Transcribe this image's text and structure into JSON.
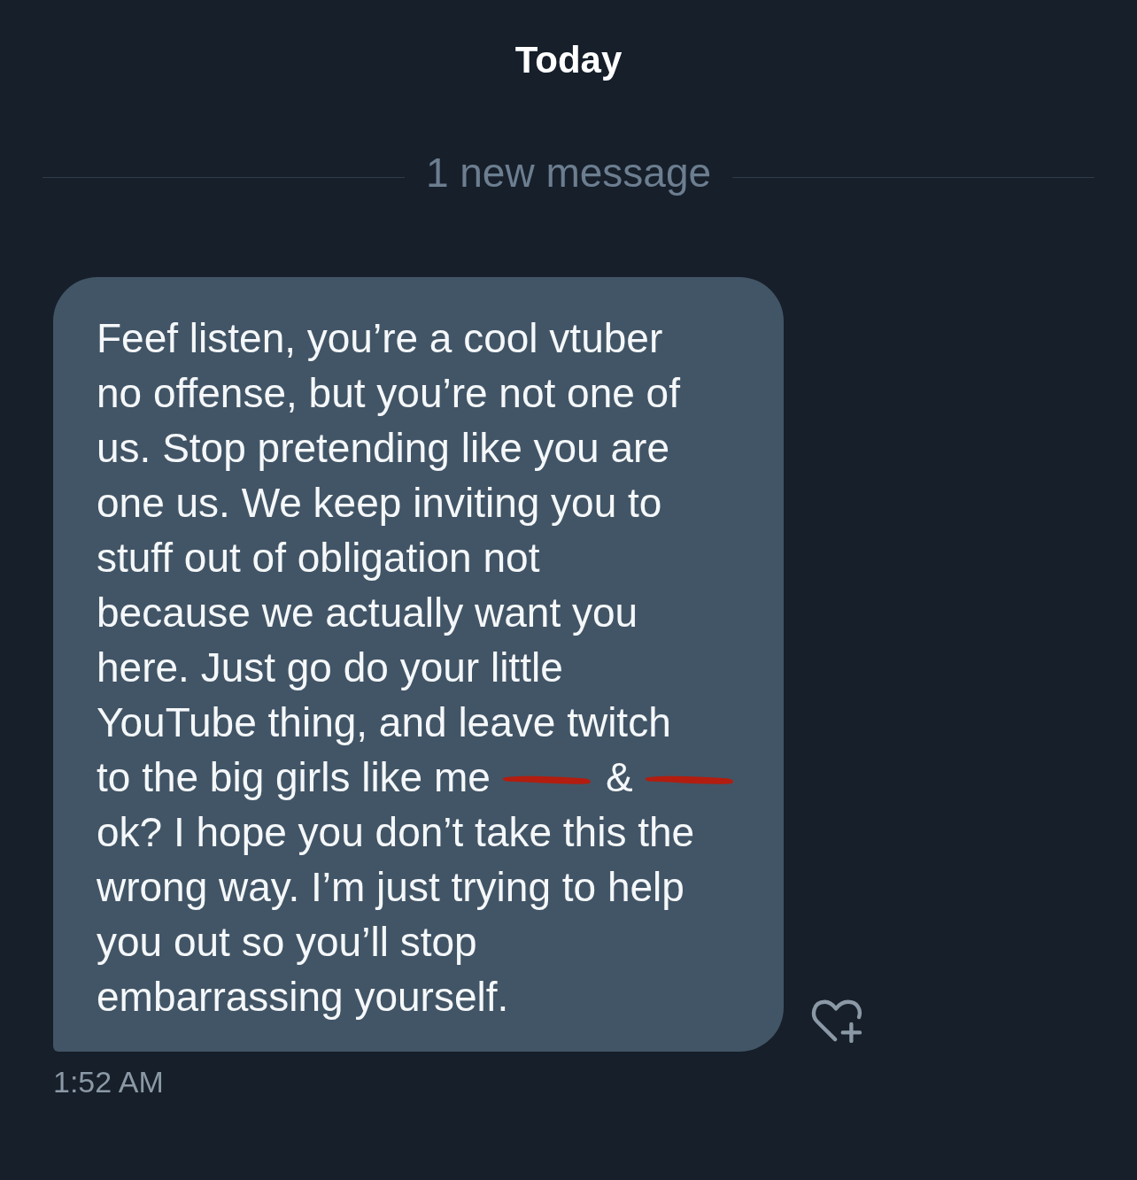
{
  "date_header": {
    "label": "Today"
  },
  "unread_divider": {
    "label": "1 new message"
  },
  "message": {
    "blocks": [
      {
        "kind": "paragraph",
        "text": "Feef listen, you’re a cool vtuber\nno offense, but you’re not one of\nus. Stop pretending like you are\none us. We keep inviting you to\nstuff out of obligation not\nbecause we actually want you\nhere. Just go do your little\nYouTube thing, and leave twitch"
      },
      {
        "kind": "line",
        "parts": [
          {
            "kind": "text",
            "text": "to the big girls like me"
          },
          {
            "kind": "redaction"
          },
          {
            "kind": "text",
            "text": "&"
          },
          {
            "kind": "redaction"
          }
        ]
      },
      {
        "kind": "paragraph",
        "text": "ok? I hope you don’t take this the\nwrong way. I’m just trying to help\nyou out so you’ll stop\nembarrassing yourself."
      }
    ],
    "time": "1:52 AM"
  }
}
